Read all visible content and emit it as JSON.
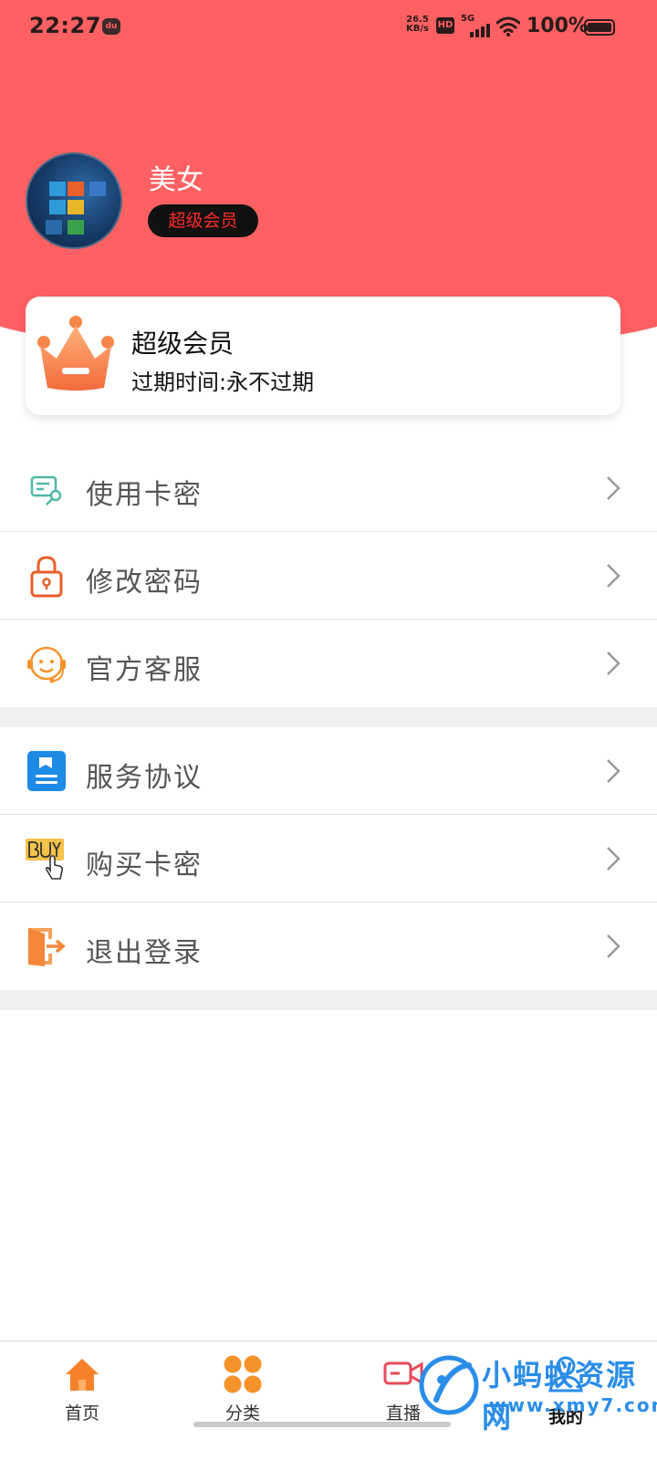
{
  "status_bar": {
    "time": "22:27",
    "net_speed_value": "26.5",
    "net_speed_unit": "KB/s",
    "hd_label": "HD",
    "network_label": "5G",
    "battery_text": "100%"
  },
  "profile": {
    "username": "美女",
    "vip_badge": "超级会员"
  },
  "member_card": {
    "title": "超级会员",
    "expire_text": "过期时间:永不过期"
  },
  "menu_group_1": [
    {
      "label": "使用卡密",
      "icon": "card-key-icon"
    },
    {
      "label": "修改密码",
      "icon": "lock-icon"
    },
    {
      "label": "官方客服",
      "icon": "customer-service-icon"
    }
  ],
  "menu_group_2": [
    {
      "label": "服务协议",
      "icon": "agreement-icon"
    },
    {
      "label": "购买卡密",
      "icon": "buy-icon"
    },
    {
      "label": "退出登录",
      "icon": "logout-icon"
    }
  ],
  "bottom_nav": [
    {
      "label": "首页",
      "icon": "home-icon"
    },
    {
      "label": "分类",
      "icon": "category-icon"
    },
    {
      "label": "直播",
      "icon": "live-icon"
    },
    {
      "label": "我的",
      "icon": "profile-icon"
    }
  ],
  "watermark": {
    "text": "小蚂蚁资源网",
    "url": "www.xmy7.com"
  },
  "colors": {
    "header": "#ff6163",
    "vip_text": "#ff2a2a",
    "accent_orange": "#f5822a",
    "watermark_blue": "#2a8de8"
  }
}
